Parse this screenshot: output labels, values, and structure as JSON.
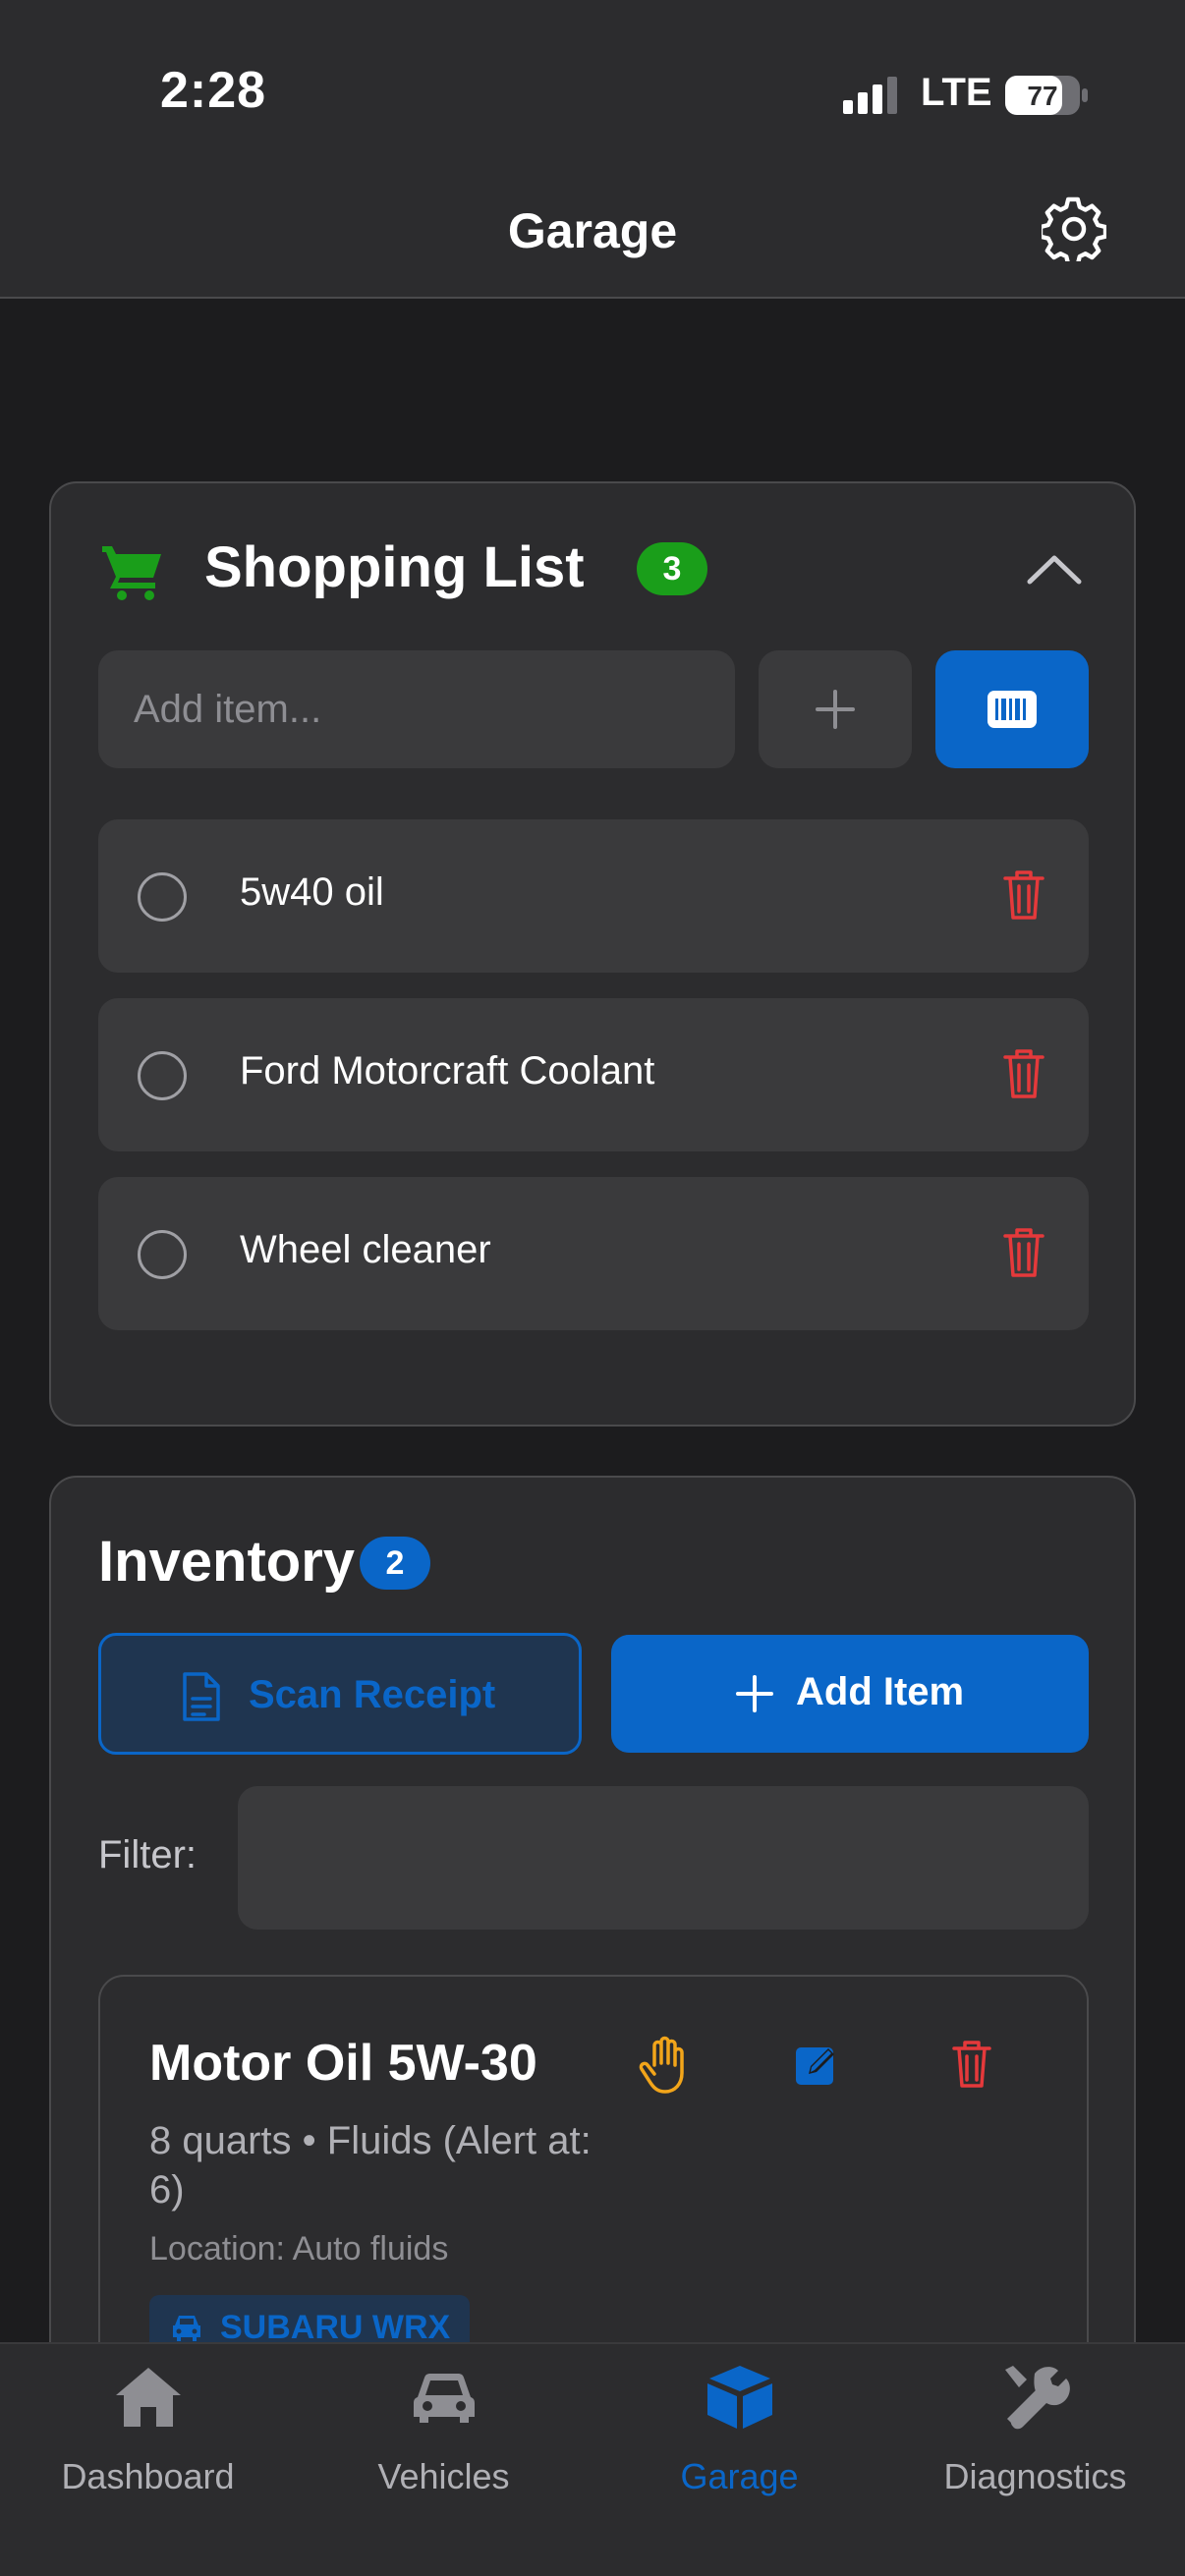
{
  "status_bar": {
    "time": "2:28",
    "network": "LTE",
    "battery": "77"
  },
  "header": {
    "title": "Garage"
  },
  "shopping_list": {
    "title": "Shopping List",
    "count": "3",
    "input_placeholder": "Add item...",
    "items": [
      {
        "label": "5w40 oil"
      },
      {
        "label": "Ford Motorcraft Coolant"
      },
      {
        "label": "Wheel cleaner"
      }
    ]
  },
  "inventory": {
    "title": "Inventory",
    "count": "2",
    "scan_label": "Scan Receipt",
    "add_label": "Add Item",
    "filter_label": "Filter:",
    "items": [
      {
        "name": "Motor Oil 5W-30",
        "detail": "8 quarts • Fluids (Alert at: 6)",
        "location": "Location: Auto fluids",
        "vehicle": "SUBARU WRX"
      }
    ]
  },
  "tabs": [
    {
      "label": "Dashboard",
      "icon": "home-icon"
    },
    {
      "label": "Vehicles",
      "icon": "car-icon"
    },
    {
      "label": "Garage",
      "icon": "cube-icon",
      "active": true
    },
    {
      "label": "Diagnostics",
      "icon": "tools-icon"
    }
  ],
  "colors": {
    "accent": "#0a66c8",
    "success": "#1a9e1a",
    "danger": "#e5393b",
    "warning": "#f2a51a"
  }
}
